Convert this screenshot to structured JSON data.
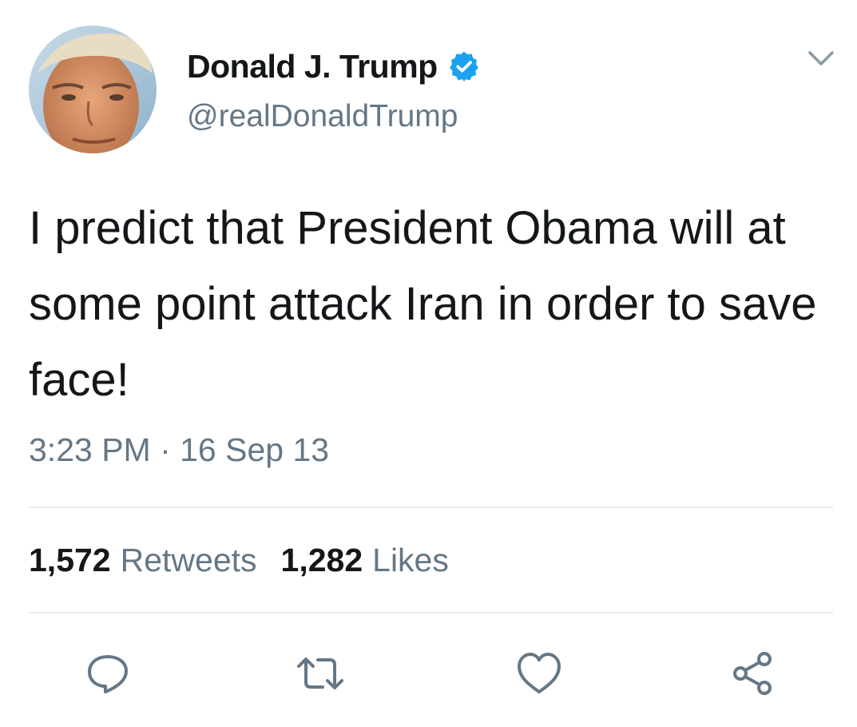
{
  "author": {
    "display_name": "Donald J. Trump",
    "handle": "@realDonaldTrump",
    "verified": true,
    "avatar_icon": "profile-photo-avatar"
  },
  "tweet": {
    "text": "I predict that President Obama will at some point attack Iran in order to save face!",
    "timestamp": "3:23 PM · 16 Sep 13"
  },
  "stats": {
    "retweets_count": "1,572",
    "retweets_label": "Retweets",
    "likes_count": "1,282",
    "likes_label": "Likes"
  },
  "actions": [
    {
      "name": "reply",
      "icon": "speech-bubble-icon"
    },
    {
      "name": "retweet",
      "icon": "retweet-arrows-icon"
    },
    {
      "name": "like",
      "icon": "heart-icon"
    },
    {
      "name": "share",
      "icon": "share-icon"
    }
  ],
  "colors": {
    "primary_text": "#14171a",
    "secondary_text": "#657786",
    "verified_blue": "#1da1f2",
    "divider": "#e6ecf0"
  }
}
